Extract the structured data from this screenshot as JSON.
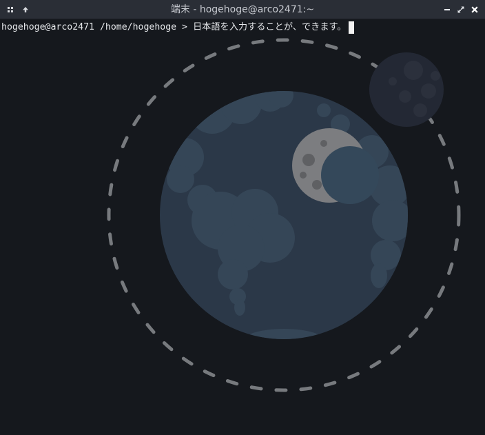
{
  "window": {
    "title": "端末 - hogehoge@arco2471:~"
  },
  "titlebar": {
    "left_buttons": [
      "menu-icon",
      "keep-above-icon"
    ],
    "right_buttons": [
      "minimize-icon",
      "maximize-icon",
      "close-icon"
    ]
  },
  "terminal": {
    "user_host": "hogehoge@arco2471",
    "cwd": "/home/hogehoge",
    "prompt_symbol": ">",
    "input_text": "日本語を入力することが、できます。"
  },
  "colors": {
    "background": "#15181d",
    "titlebar": "#2a2e36",
    "text": "#e6e8eb",
    "earth": "#2b3848",
    "land": "#354657",
    "orbit": "#777a7e"
  }
}
